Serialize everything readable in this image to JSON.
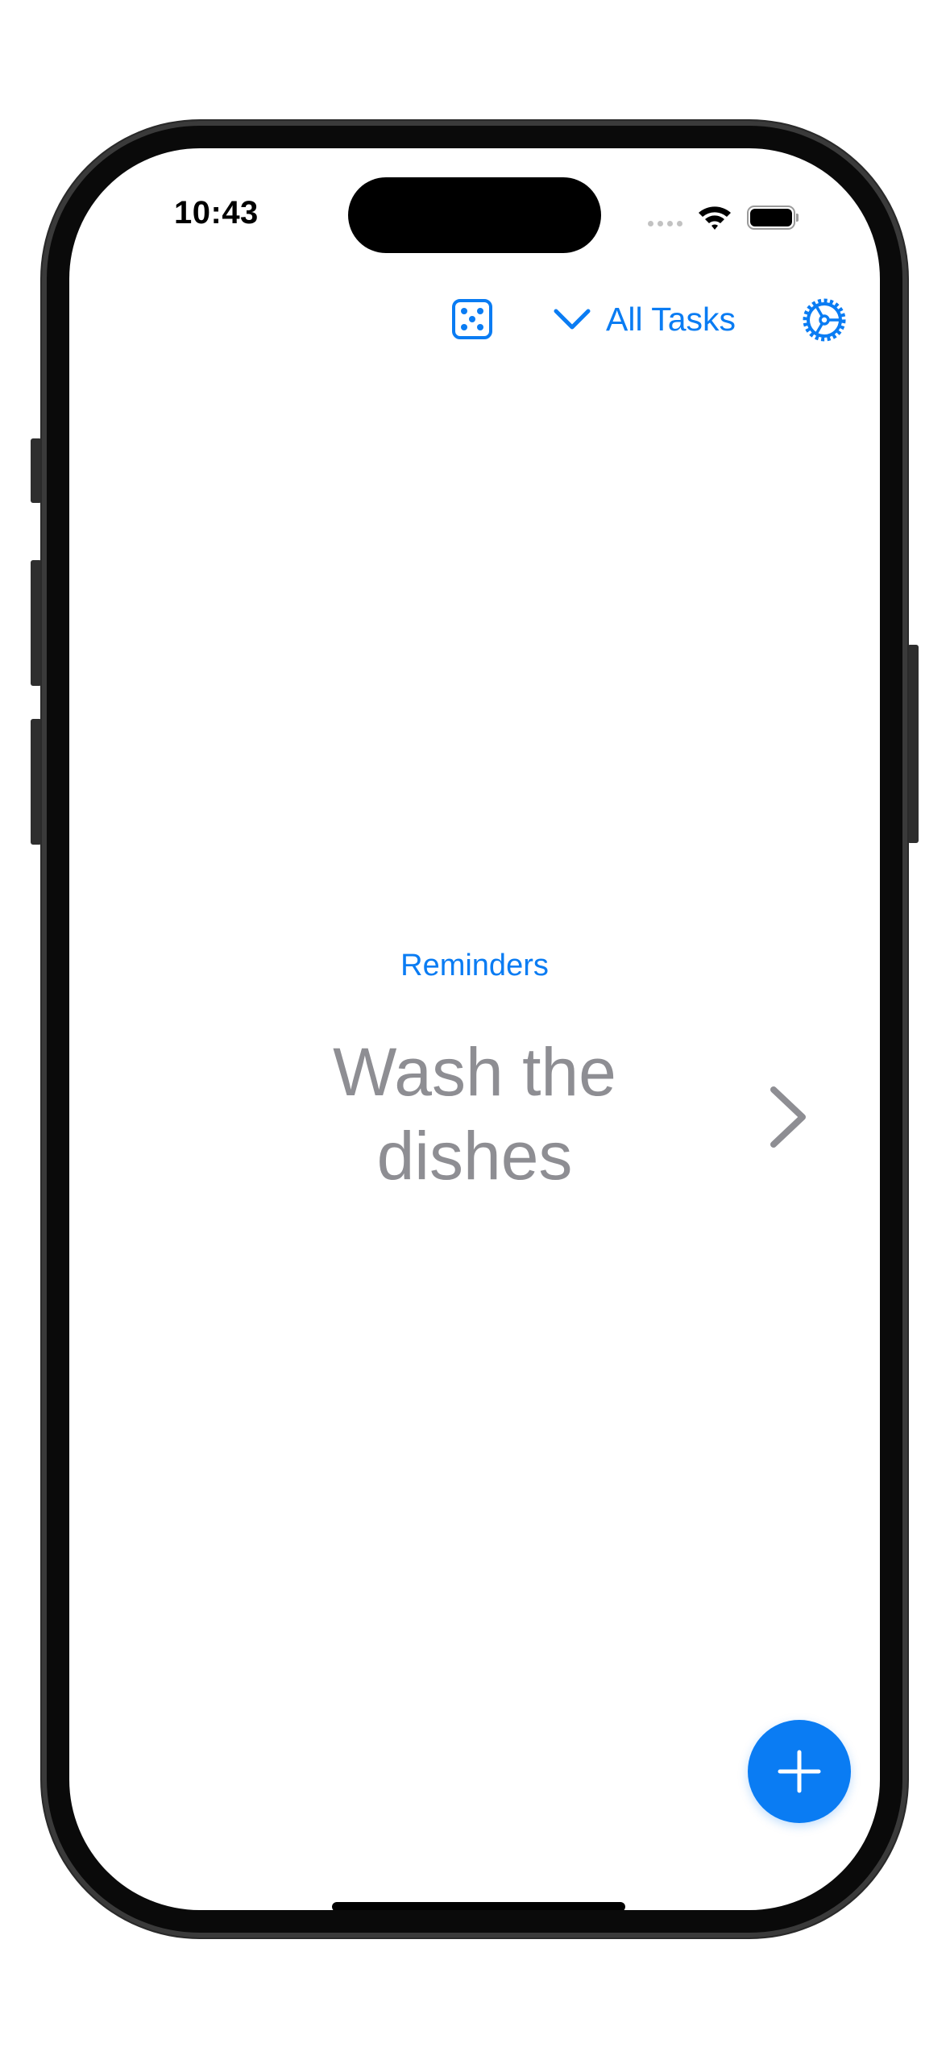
{
  "status_bar": {
    "time": "10:43"
  },
  "nav": {
    "filter_label": "All Tasks",
    "icons": [
      "dice-icon",
      "chevron-down-icon",
      "gear-icon"
    ]
  },
  "task": {
    "category": "Reminders",
    "title_line1": "Wash the",
    "title_line2": "dishes"
  },
  "actions": {
    "add_icon": "plus-icon",
    "next_icon": "chevron-right-icon"
  },
  "colors": {
    "accent": "#0a7cf3",
    "task_text": "#8e8e93",
    "background": "#ffffff"
  }
}
